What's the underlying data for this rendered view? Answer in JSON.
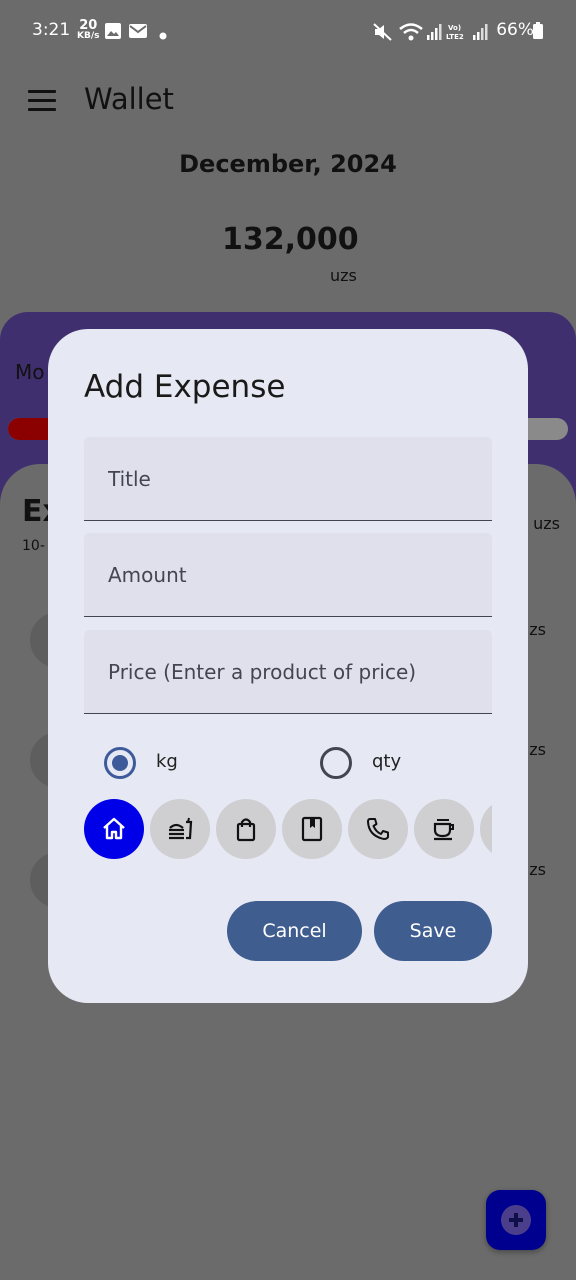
{
  "status_bar": {
    "time": "3:21",
    "net_speed_value": "20",
    "net_speed_unit": "KB/s",
    "battery": "66%"
  },
  "app_bar": {
    "title": "Wallet"
  },
  "summary": {
    "month": "December, 2024",
    "total": "132,000",
    "currency": "uzs"
  },
  "background": {
    "card_label": "Mo",
    "list_title": "Ex",
    "list_sub": "10-",
    "list_right": "uzs",
    "rows": [
      {
        "amount": "zs"
      },
      {
        "amount": "zs"
      },
      {
        "amount": "zs"
      }
    ]
  },
  "dialog": {
    "title": "Add Expense",
    "fields": {
      "title_placeholder": "Title",
      "title_value": "",
      "amount_placeholder": "Amount",
      "amount_value": "",
      "price_placeholder": "Price (Enter a product of price)",
      "price_value": ""
    },
    "unit_options": [
      {
        "label": "kg",
        "selected": true
      },
      {
        "label": "qty",
        "selected": false
      }
    ],
    "categories": [
      {
        "icon": "home-icon",
        "selected": true
      },
      {
        "icon": "fastfood-icon",
        "selected": false
      },
      {
        "icon": "shopping-bag-icon",
        "selected": false
      },
      {
        "icon": "book-icon",
        "selected": false
      },
      {
        "icon": "phone-icon",
        "selected": false
      },
      {
        "icon": "coffee-icon",
        "selected": false
      },
      {
        "icon": "more-category-icon",
        "selected": false
      }
    ],
    "cancel_label": "Cancel",
    "save_label": "Save"
  },
  "colors": {
    "scrim": "#6b6b6b",
    "dialog_bg": "#e6e8f3",
    "accent": "#3f5d8f",
    "selected_category": "#0000e8",
    "fab": "#00008e",
    "budget_card": "#3f2f6e"
  }
}
